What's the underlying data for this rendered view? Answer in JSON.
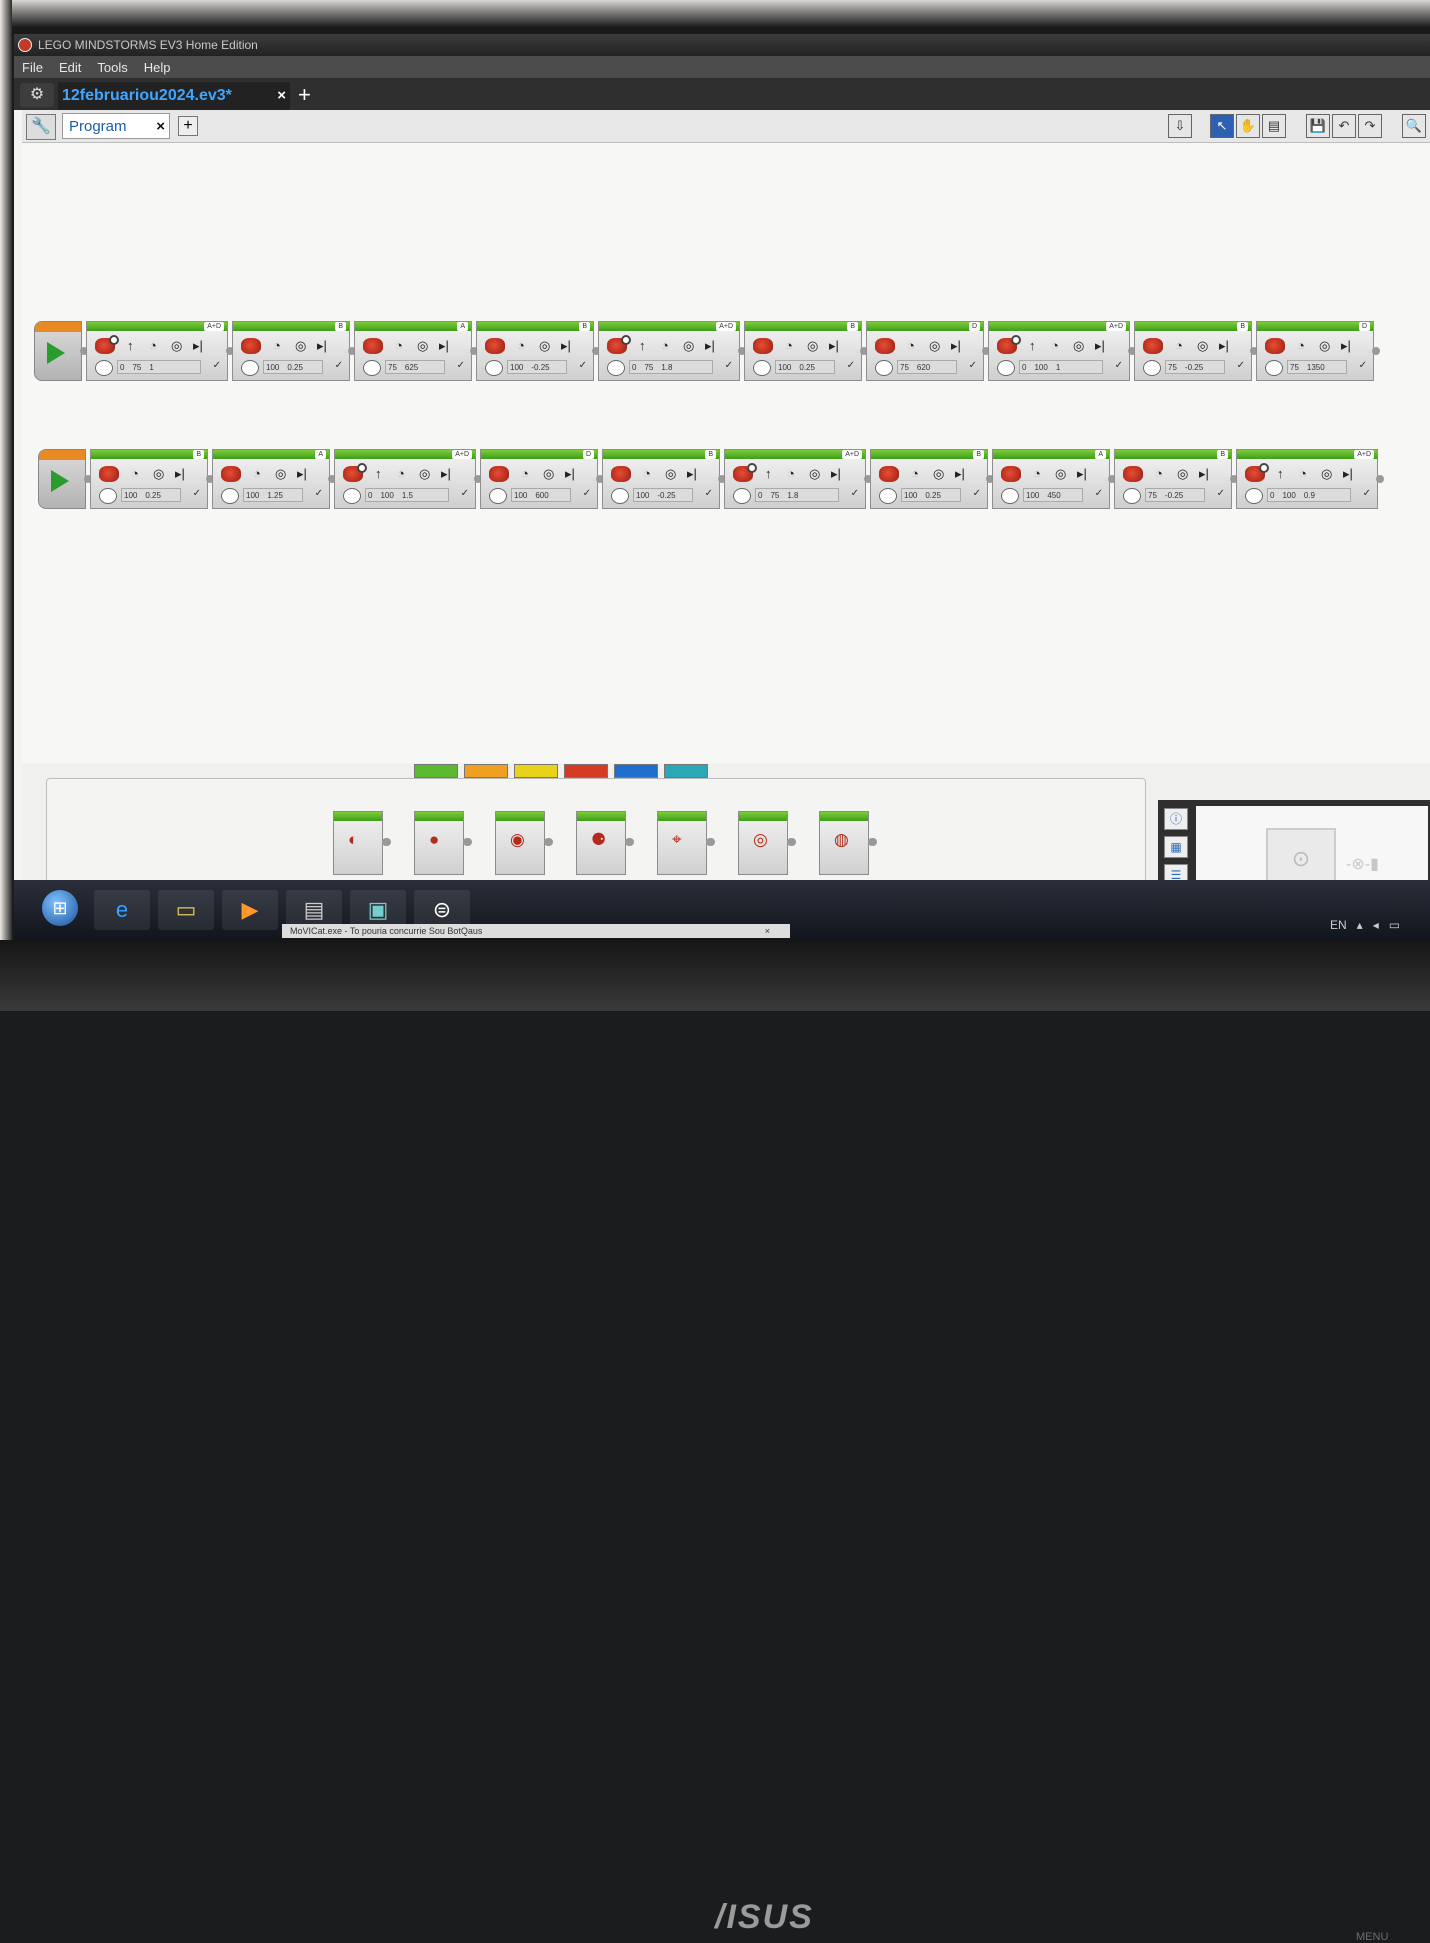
{
  "window": {
    "title": "LEGO MINDSTORMS EV3 Home Edition"
  },
  "menu": [
    "File",
    "Edit",
    "Tools",
    "Help"
  ],
  "file_tab": {
    "label": "12februariou2024.ev3*",
    "close": "×",
    "add": "+"
  },
  "program_tab": {
    "label": "Program",
    "close": "×",
    "add": "+"
  },
  "toolbar_icons": [
    "download-icon",
    "select-icon",
    "pan-icon",
    "comment-icon",
    "save-icon",
    "undo-icon",
    "redo-icon",
    "zoom-icon"
  ],
  "sequence_1": [
    {
      "type": "steering",
      "port": "A+D",
      "values": [
        "0",
        "75",
        "1"
      ]
    },
    {
      "type": "medium",
      "port": "B",
      "values": [
        "100",
        "0.25"
      ]
    },
    {
      "type": "medium",
      "port": "A",
      "values": [
        "75",
        "625"
      ]
    },
    {
      "type": "medium",
      "port": "B",
      "values": [
        "100",
        "-0.25"
      ]
    },
    {
      "type": "steering",
      "port": "A+D",
      "values": [
        "0",
        "75",
        "1.8"
      ]
    },
    {
      "type": "medium",
      "port": "B",
      "values": [
        "100",
        "0.25"
      ]
    },
    {
      "type": "medium",
      "port": "D",
      "values": [
        "75",
        "620"
      ]
    },
    {
      "type": "steering",
      "port": "A+D",
      "values": [
        "0",
        "100",
        "1"
      ]
    },
    {
      "type": "medium",
      "port": "B",
      "values": [
        "75",
        "-0.25"
      ]
    },
    {
      "type": "medium",
      "port": "D",
      "values": [
        "75",
        "1350"
      ]
    }
  ],
  "sequence_2": [
    {
      "type": "medium",
      "port": "B",
      "values": [
        "100",
        "0.25"
      ]
    },
    {
      "type": "medium",
      "port": "A",
      "values": [
        "100",
        "1.25"
      ]
    },
    {
      "type": "steering",
      "port": "A+D",
      "values": [
        "0",
        "100",
        "1.5"
      ]
    },
    {
      "type": "medium",
      "port": "D",
      "values": [
        "100",
        "600"
      ]
    },
    {
      "type": "medium",
      "port": "B",
      "values": [
        "100",
        "-0.25"
      ]
    },
    {
      "type": "steering",
      "port": "A+D",
      "values": [
        "0",
        "75",
        "1.8"
      ]
    },
    {
      "type": "medium",
      "port": "B",
      "values": [
        "100",
        "0.25"
      ]
    },
    {
      "type": "medium",
      "port": "A",
      "values": [
        "100",
        "450"
      ]
    },
    {
      "type": "medium",
      "port": "B",
      "values": [
        "75",
        "-0.25"
      ]
    },
    {
      "type": "steering",
      "port": "A+D",
      "values": [
        "0",
        "100",
        "0.9"
      ]
    }
  ],
  "palette": {
    "tab_colors": [
      "#5cb82e",
      "#f0a020",
      "#e8d21a",
      "#d43a24",
      "#1f6fcf",
      "#2aa8b8"
    ],
    "blocks": [
      "medium-motor",
      "large-motor",
      "move-steering",
      "move-tank",
      "display",
      "sound",
      "brick-status-light"
    ]
  },
  "taskbar": {
    "tray_lang": "EN",
    "tooltip": "MoVICat.exe - To pouria concurrie Sou BotQaus",
    "tooltip_close": "×"
  },
  "bezel": {
    "brand": "/ISUS",
    "menu": "MENU"
  }
}
